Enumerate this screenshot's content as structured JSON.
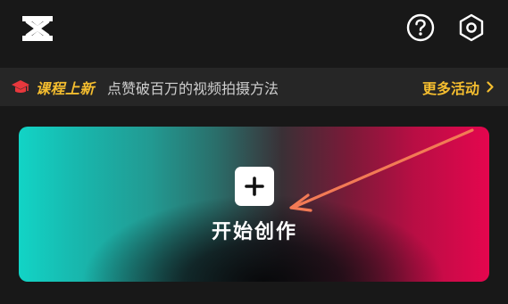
{
  "header": {
    "logo_icon": "capcut-logo-icon",
    "help_icon": "question-circle-icon",
    "settings_icon": "hexagon-gear-icon"
  },
  "banner": {
    "icon": "graduation-cap-icon",
    "tag": "课程上新",
    "text": "点赞破百万的视频拍摄方法",
    "more_label": "更多活动",
    "more_icon": "chevron-right-icon"
  },
  "create": {
    "label": "开始创作",
    "plus_icon": "plus-icon"
  },
  "annotation": {
    "arrow_color": "#f27a55"
  },
  "colors": {
    "background": "#181818",
    "banner_bg": "#262626",
    "accent": "#f4bd2f",
    "gradient_left": "#12d4c6",
    "gradient_right": "#e4064e"
  }
}
